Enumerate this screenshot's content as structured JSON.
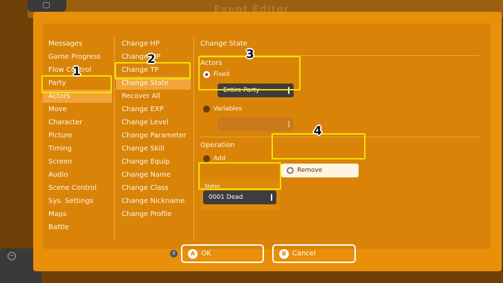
{
  "window_title": "Event Editor",
  "command_categories": [
    "Messages",
    "Game Progress",
    "Flow Control",
    "Party",
    "Actors",
    "Move",
    "Character",
    "Picture",
    "Timing",
    "Screen",
    "Audio",
    "Scene Control",
    "Sys. Settings",
    "Maps",
    "Battle"
  ],
  "selected_category": "Actors",
  "commands": [
    "Change HP",
    "Change MP",
    "Change TP",
    "Change State",
    "Recover All",
    "Change EXP",
    "Change Level",
    "Change Parameter",
    "Change Skill",
    "Change Equip",
    "Change Name",
    "Change Class",
    "Change Nickname",
    "Change Profile"
  ],
  "selected_command": "Change State",
  "details": {
    "title": "Change State",
    "actors_section": "Actors",
    "fixed_label": "Fixed",
    "fixed_value": "Entire Party",
    "variables_label": "Variables",
    "variables_value": "",
    "operation_section": "Operation",
    "add_label": "Add",
    "remove_label": "Remove",
    "states_label": "States",
    "states_value": "0001 Dead"
  },
  "footer": {
    "x_glyph": "X",
    "ok_glyph": "A",
    "ok_label": "OK",
    "cancel_glyph": "B",
    "cancel_label": "Cancel"
  },
  "annotations": [
    "1",
    "2",
    "3",
    "4"
  ],
  "colors": {
    "dialog": "#e8900a",
    "panel": "#d98409",
    "selection": "#f1a53a",
    "highlight": "#f5e400",
    "dropdown": "#3d3d3d"
  }
}
